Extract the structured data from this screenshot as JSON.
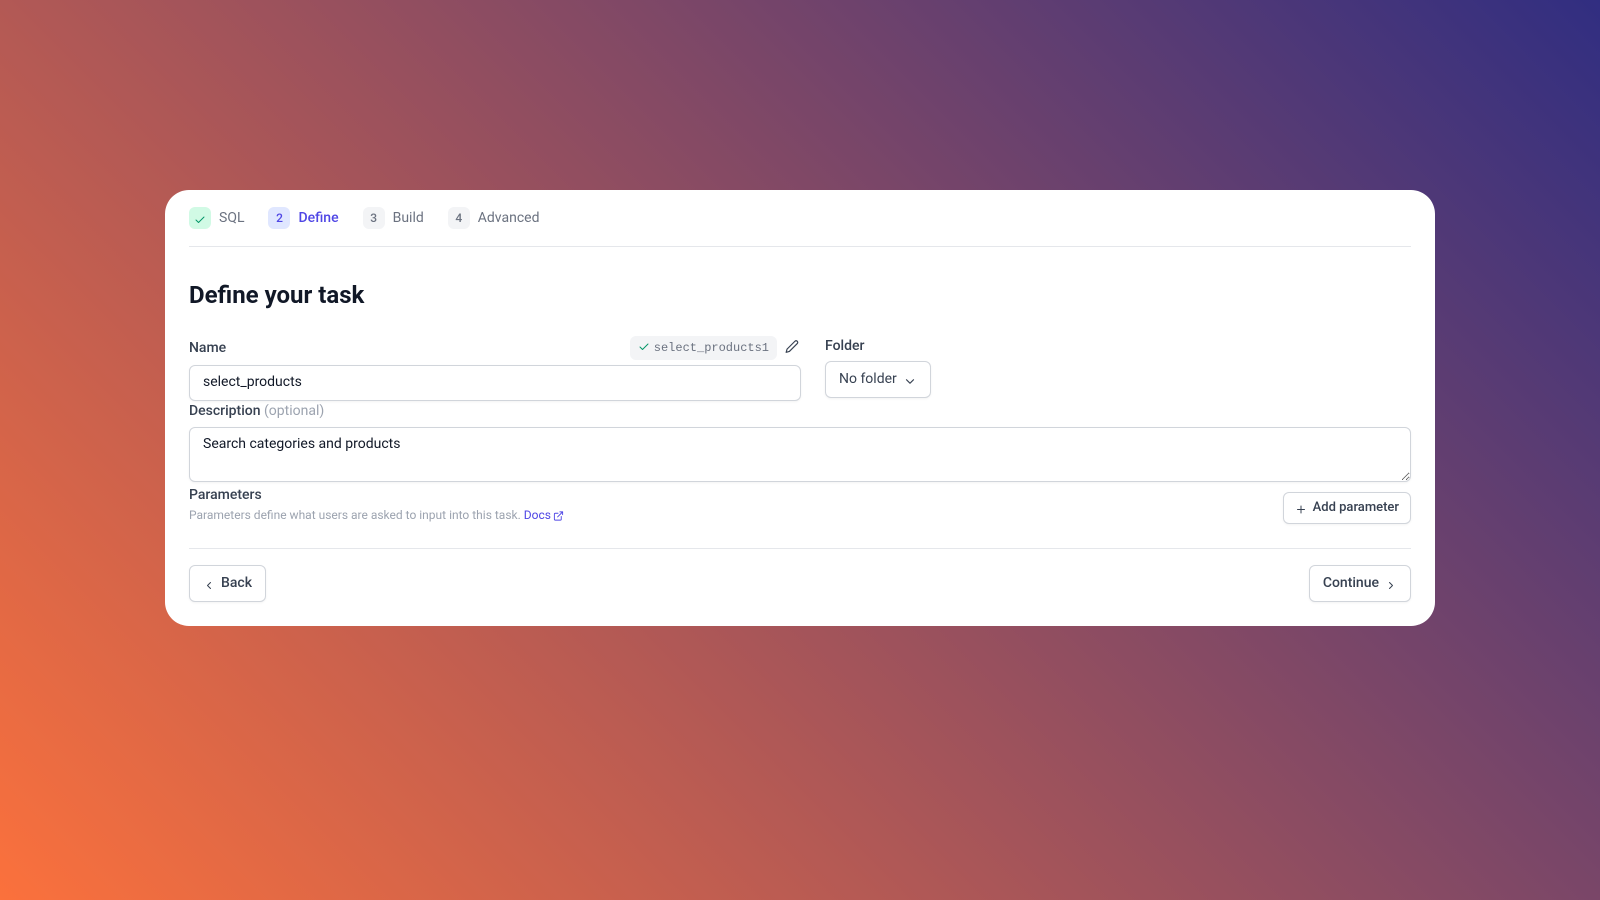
{
  "stepper": {
    "steps": [
      {
        "label": "SQL",
        "state": "done"
      },
      {
        "num": "2",
        "label": "Define",
        "state": "current"
      },
      {
        "num": "3",
        "label": "Build",
        "state": ""
      },
      {
        "num": "4",
        "label": "Advanced",
        "state": ""
      }
    ]
  },
  "title": "Define your task",
  "name_field": {
    "label": "Name",
    "value": "select_products",
    "slug": "select_products1"
  },
  "folder": {
    "label": "Folder",
    "selected": "No folder"
  },
  "description": {
    "label": "Description",
    "optional": "(optional)",
    "value": "Search categories and products"
  },
  "parameters": {
    "title": "Parameters",
    "helper": "Parameters define what users are asked to input into this task. ",
    "docs_label": "Docs",
    "add_label": "Add parameter"
  },
  "footer": {
    "back": "Back",
    "continue": "Continue"
  }
}
